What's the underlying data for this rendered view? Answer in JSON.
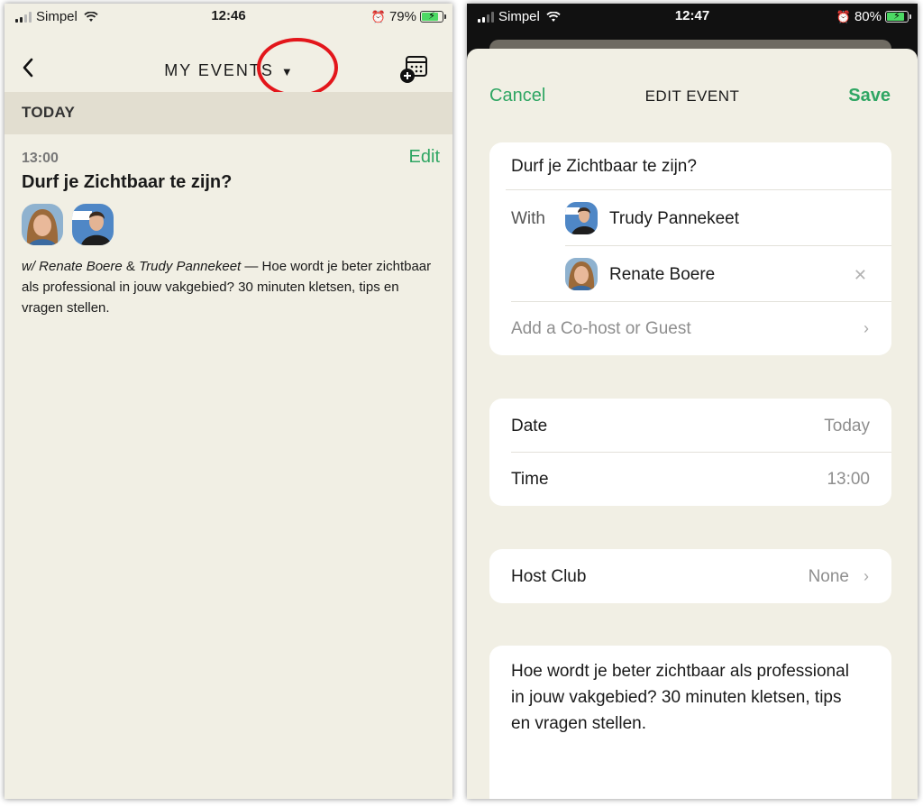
{
  "left": {
    "status": {
      "carrier": "Simpel",
      "time": "12:46",
      "battery": "79%"
    },
    "header": {
      "title": "MY EVENTS",
      "caret": "▼"
    },
    "section": "TODAY",
    "event": {
      "time": "13:00",
      "edit": "Edit",
      "title": "Durf je Zichtbaar te zijn?",
      "with_prefix": "w/ ",
      "host1": "Renate Boere",
      "amp": " & ",
      "host2": "Trudy Pannekeet",
      "desc": " — Hoe wordt je beter zichtbaar als professional in jouw vakgebied? 30 minuten kletsen, tips en vragen stellen."
    }
  },
  "right": {
    "status": {
      "carrier": "Simpel",
      "time": "12:47",
      "battery": "80%"
    },
    "nav": {
      "cancel": "Cancel",
      "title": "EDIT EVENT",
      "save": "Save"
    },
    "event_name": "Durf je Zichtbaar te zijn?",
    "with_label": "With",
    "guests": [
      "Trudy Pannekeet",
      "Renate Boere"
    ],
    "add_guest": "Add a Co-host or Guest",
    "date_label": "Date",
    "date_value": "Today",
    "time_label": "Time",
    "time_value": "13:00",
    "host_club_label": "Host Club",
    "host_club_value": "None",
    "description": "Hoe wordt je beter zichtbaar als professional in jouw vakgebied? 30 minuten kletsen, tips en vragen stellen."
  },
  "icons": {
    "back": "chevron-left-icon",
    "calendar_add": "calendar-plus-icon",
    "chevron": "chevron-right-icon",
    "remove": "close-icon"
  },
  "colors": {
    "accent": "#2fa663",
    "background": "#f1efe4",
    "highlight": "#e3161b",
    "section": "#e2ded0"
  }
}
